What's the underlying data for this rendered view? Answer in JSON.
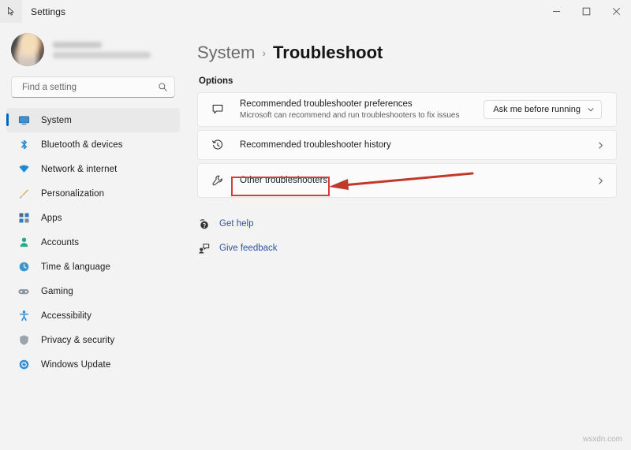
{
  "window": {
    "title": "Settings",
    "cursor_icon": "cursor-pointer-icon",
    "controls": {
      "minimize": "minimize-icon",
      "maximize": "maximize-icon",
      "close": "close-icon"
    }
  },
  "account": {
    "name_redacted": "",
    "email_redacted": "",
    "avatar_icon": "user-avatar"
  },
  "search": {
    "placeholder": "Find a setting",
    "value": "",
    "icon": "search-icon"
  },
  "sidebar": {
    "items": [
      {
        "label": "System",
        "icon": "monitor-icon",
        "selected": true
      },
      {
        "label": "Bluetooth & devices",
        "icon": "bluetooth-icon",
        "selected": false
      },
      {
        "label": "Network & internet",
        "icon": "wifi-icon",
        "selected": false
      },
      {
        "label": "Personalization",
        "icon": "brush-icon",
        "selected": false
      },
      {
        "label": "Apps",
        "icon": "apps-grid-icon",
        "selected": false
      },
      {
        "label": "Accounts",
        "icon": "person-icon",
        "selected": false
      },
      {
        "label": "Time & language",
        "icon": "globe-clock-icon",
        "selected": false
      },
      {
        "label": "Gaming",
        "icon": "gamepad-icon",
        "selected": false
      },
      {
        "label": "Accessibility",
        "icon": "accessibility-icon",
        "selected": false
      },
      {
        "label": "Privacy & security",
        "icon": "shield-icon",
        "selected": false
      },
      {
        "label": "Windows Update",
        "icon": "update-sync-icon",
        "selected": false
      }
    ]
  },
  "main": {
    "breadcrumb": {
      "root": "System",
      "separator": "›",
      "current": "Troubleshoot"
    },
    "section_label": "Options",
    "cards": [
      {
        "title": "Recommended troubleshooter preferences",
        "subtitle": "Microsoft can recommend and run troubleshooters to fix issues",
        "icon": "speech-bubble-icon",
        "control": "dropdown",
        "dropdown_value": "Ask me before running"
      },
      {
        "title": "Recommended troubleshooter history",
        "subtitle": "",
        "icon": "history-clock-icon",
        "control": "chevron",
        "dropdown_value": ""
      },
      {
        "title": "Other troubleshooters",
        "subtitle": "",
        "icon": "wrench-icon",
        "control": "chevron",
        "dropdown_value": ""
      }
    ],
    "links": [
      {
        "label": "Get help",
        "icon": "help-question-icon"
      },
      {
        "label": "Give feedback",
        "icon": "feedback-person-icon"
      }
    ]
  },
  "annotation": {
    "highlight_color": "#d93b3b",
    "arrow_color": "#c0392b",
    "target": "Other troubleshooters"
  },
  "watermark": "wsxdn.com"
}
